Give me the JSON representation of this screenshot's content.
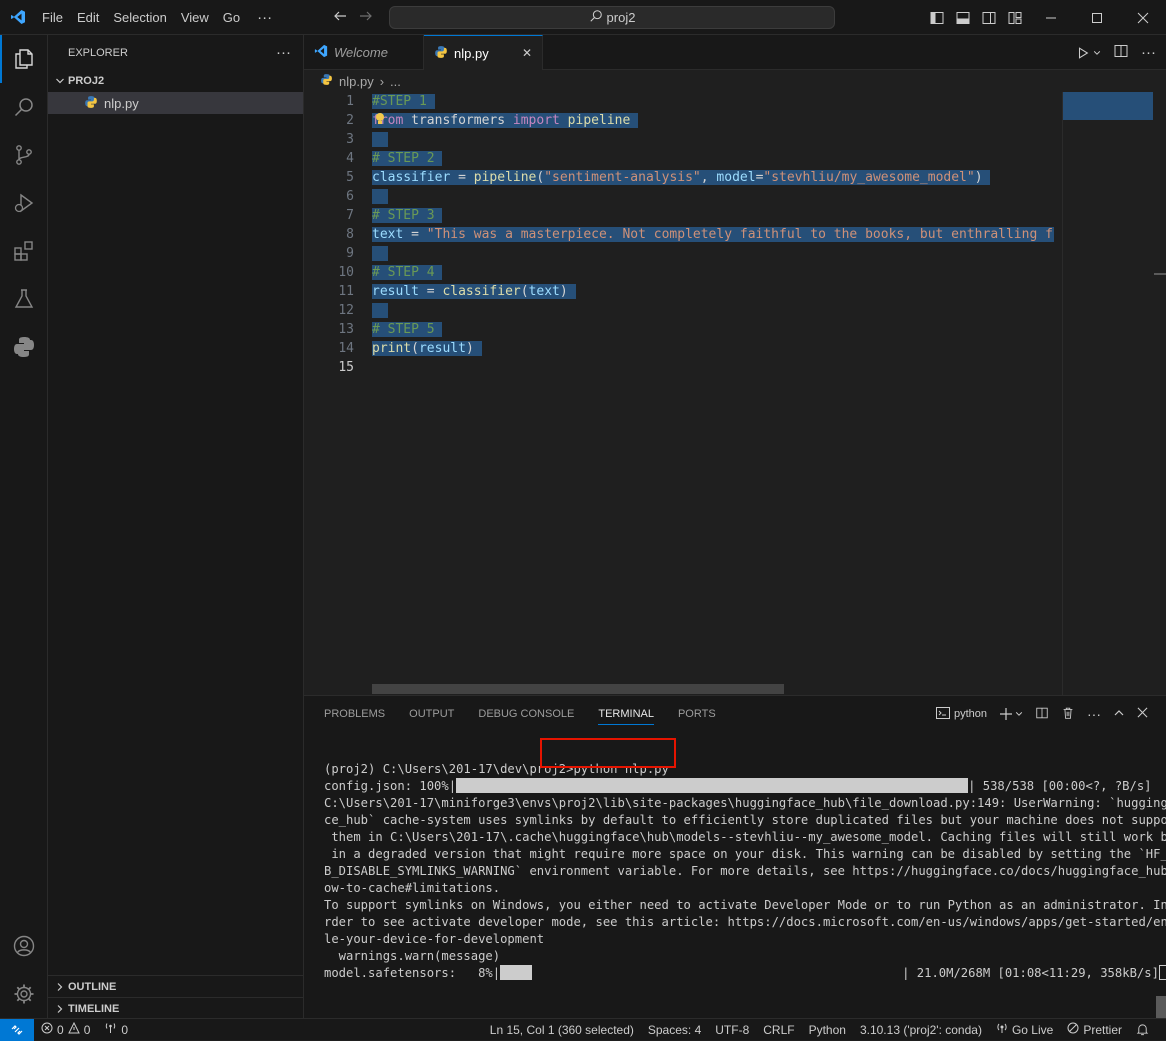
{
  "menu": {
    "file": "File",
    "edit": "Edit",
    "selection": "Selection",
    "view": "View",
    "go": "Go",
    "more": "···"
  },
  "command_center": {
    "text": "proj2"
  },
  "sidebar": {
    "title": "EXPLORER",
    "more": "···",
    "folder": "PROJ2",
    "file": "nlp.py",
    "outline": "OUTLINE",
    "timeline": "TIMELINE"
  },
  "tabs": [
    {
      "label": "Welcome"
    },
    {
      "label": "nlp.py",
      "close": "✕"
    }
  ],
  "breadcrumb": {
    "file": "nlp.py",
    "sep": "›",
    "rest": "..."
  },
  "editor": {
    "line_numbers": [
      "1",
      "2",
      "3",
      "4",
      "5",
      "6",
      "7",
      "8",
      "9",
      "10",
      "11",
      "12",
      "13",
      "14",
      "15"
    ],
    "lines": {
      "l1": "#STEP 1",
      "l2_kw1": "from",
      "l2_mod": " transformers ",
      "l2_kw2": "import",
      "l2_fn": " pipeline",
      "l4": "# STEP 2",
      "l5_var": "classifier",
      "l5_op": " = ",
      "l5_fn": "pipeline",
      "l5_p1": "(",
      "l5_str1": "\"sentiment-analysis\"",
      "l5_p2": ", ",
      "l5_var2": "model",
      "l5_p3": "=",
      "l5_str2": "\"stevhliu/my_awesome_model\"",
      "l5_p4": ")",
      "l7": "# STEP 3",
      "l8_var": "text",
      "l8_op": " = ",
      "l8_str": "\"This was a masterpiece. Not completely faithful to the books, but enthralling fro",
      "l10": "# STEP 4",
      "l11_var": "result",
      "l11_op": " = ",
      "l11_fn": "classifier",
      "l11_p1": "(",
      "l11_var2": "text",
      "l11_p2": ")",
      "l13": "# STEP 5",
      "l14_fn": "print",
      "l14_p1": "(",
      "l14_var": "result",
      "l14_p2": ")"
    }
  },
  "panel": {
    "tabs": [
      "PROBLEMS",
      "OUTPUT",
      "DEBUG CONSOLE",
      "TERMINAL",
      "PORTS"
    ],
    "shell": "python",
    "terminal": {
      "t1a": "(proj2) C:\\Users\\201-17\\dev\\proj2>python nlp.py",
      "t2a": "config.json: 100%|",
      "t2b": "| 538/538 [00:00<?, ?B/s]",
      "t3": "C:\\Users\\201-17\\miniforge3\\envs\\proj2\\lib\\site-packages\\huggingface_hub\\file_download.py:149: UserWarning: `huggingfa",
      "t4": "ce_hub` cache-system uses symlinks by default to efficiently store duplicated files but your machine does not support",
      "t5": " them in C:\\Users\\201-17\\.cache\\huggingface\\hub\\models--stevhliu--my_awesome_model. Caching files will still work but",
      "t6": " in a degraded version that might require more space on your disk. This warning can be disabled by setting the `HF_HU",
      "t7": "B_DISABLE_SYMLINKS_WARNING` environment variable. For more details, see https://huggingface.co/docs/huggingface_hub/h",
      "t8": "ow-to-cache#limitations.",
      "t9": "To support symlinks on Windows, you either need to activate Developer Mode or to run Python as an administrator. In o",
      "t10": "rder to see activate developer mode, see this article: https://docs.microsoft.com/en-us/windows/apps/get-started/enab",
      "t11": "le-your-device-for-development",
      "t12": "  warnings.warn(message)",
      "t13a": "model.safetensors:   8%|",
      "t13b": "| 21.0M/268M [01:08<11:29, 358kB/s]",
      "config_progress": 1.0,
      "model_progress": 0.08
    }
  },
  "status": {
    "errors": "0",
    "warnings": "0",
    "ports": "0",
    "position": "Ln 15, Col 1 (360 selected)",
    "spaces": "Spaces: 4",
    "encoding": "UTF-8",
    "eol": "CRLF",
    "language": "Python",
    "interpreter": "3.10.13 ('proj2': conda)",
    "golive": "Go Live",
    "prettier": "Prettier"
  },
  "colors": {
    "accent": "#0078d4",
    "selection": "#264f78",
    "highlight_box": "#e51400"
  }
}
